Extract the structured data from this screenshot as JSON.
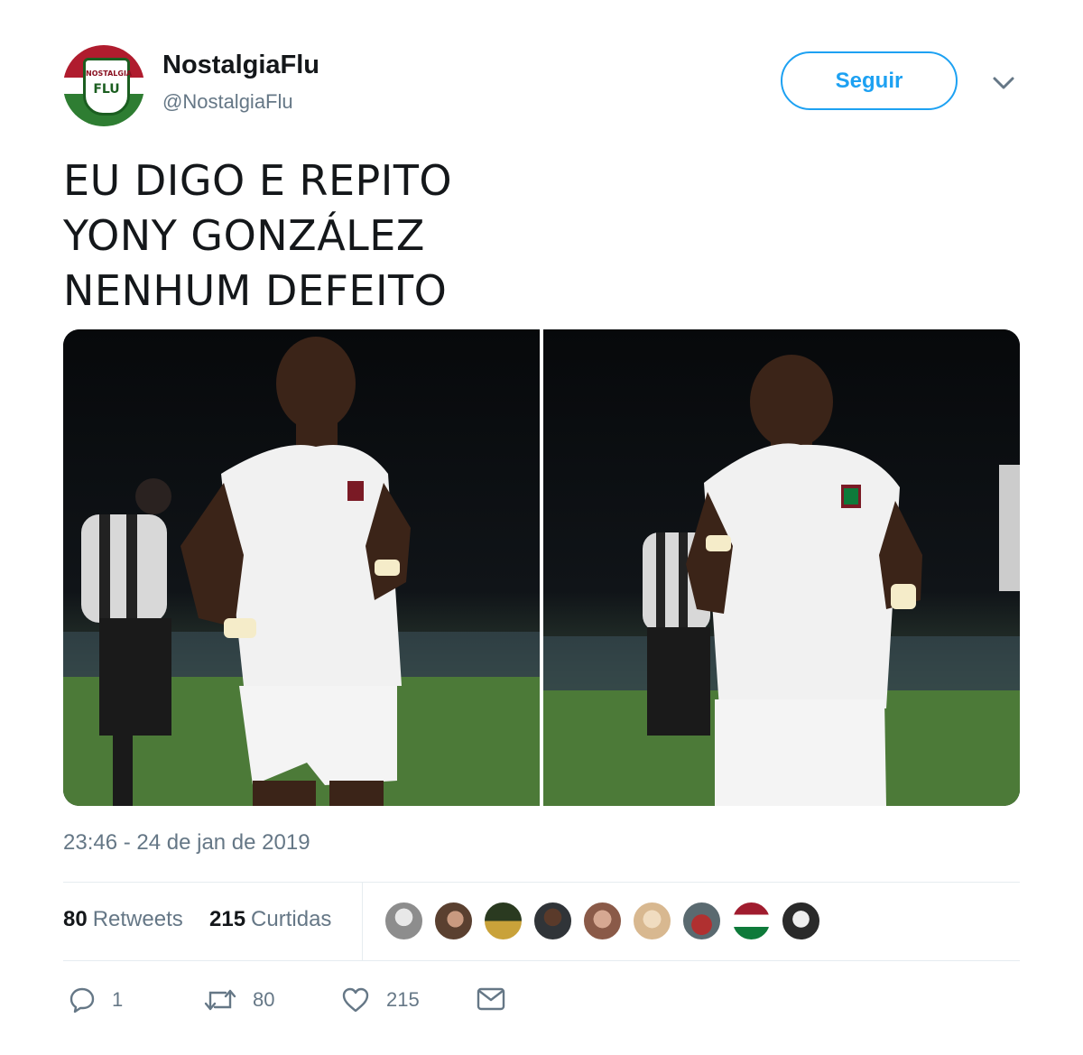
{
  "author": {
    "display_name": "NostalgiaFlu",
    "handle": "@NostalgiaFlu",
    "avatar_text_line1": "NOSTALGIA",
    "avatar_text_line2": "FLU"
  },
  "follow_button": {
    "label": "Seguir"
  },
  "tweet": {
    "lines": [
      "EU DIGO E REPITO",
      "YONY GONZÁLEZ",
      "NENHUM DEFEITO"
    ],
    "timestamp": "23:46 - 24 de jan de 2019"
  },
  "stats": {
    "retweets_count": "80",
    "retweets_label": "Retweets",
    "likes_count": "215",
    "likes_label": "Curtidas"
  },
  "liker_avatars": [
    {
      "color": "#8d8d8d"
    },
    {
      "color": "#5a4030"
    },
    {
      "color": "#c9a23a"
    },
    {
      "color": "#303438"
    },
    {
      "color": "#8a5a48"
    },
    {
      "color": "#d8b890"
    },
    {
      "color": "#a03030"
    },
    {
      "color": "#0e7a3a"
    },
    {
      "color": "#2a2a2a"
    }
  ],
  "actions": {
    "reply_count": "1",
    "retweet_count": "80",
    "like_count": "215"
  },
  "colors": {
    "accent": "#1da1f2",
    "muted": "#657786",
    "text": "#14171a"
  }
}
